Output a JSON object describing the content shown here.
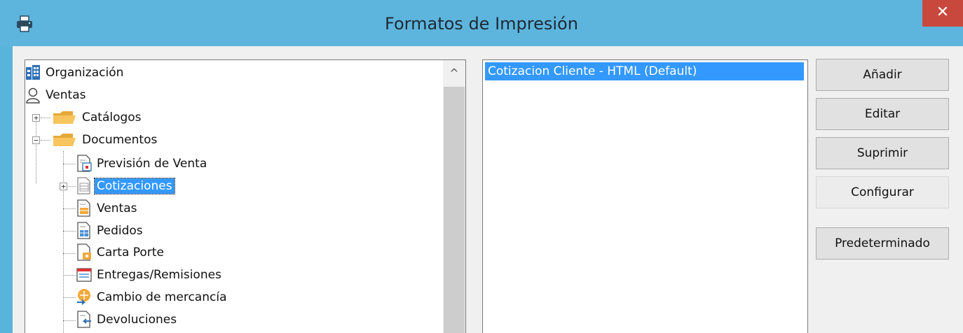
{
  "window": {
    "title": "Formatos de Impresión",
    "close_label": "✕"
  },
  "tree": {
    "items": [
      {
        "label": "Organización",
        "icon": "building-icon"
      },
      {
        "label": "Ventas",
        "icon": "user-icon"
      },
      {
        "label": "Catálogos",
        "icon": "folder-icon",
        "expander": "+"
      },
      {
        "label": "Documentos",
        "icon": "folder-icon",
        "expander": "−"
      },
      {
        "label": "Previsión de Venta",
        "icon": "document-calendar-icon"
      },
      {
        "label": "Cotizaciones",
        "icon": "document-list-icon",
        "expander": "+",
        "selected": true
      },
      {
        "label": "Ventas",
        "icon": "document-orange-icon"
      },
      {
        "label": "Pedidos",
        "icon": "document-blue-icon"
      },
      {
        "label": "Carta Porte",
        "icon": "document-truck-icon"
      },
      {
        "label": "Entregas/Remisiones",
        "icon": "delivery-icon"
      },
      {
        "label": "Cambio de mercancía",
        "icon": "exchange-icon"
      },
      {
        "label": "Devoluciones",
        "icon": "return-icon"
      }
    ],
    "scroll_up_glyph": "^"
  },
  "formats": {
    "items": [
      {
        "label": "Cotizacion Cliente - HTML (Default)",
        "selected": true
      }
    ]
  },
  "buttons": {
    "add": "Añadir",
    "edit": "Editar",
    "delete": "Suprimir",
    "configure": "Configurar",
    "set_default": "Predeterminado"
  },
  "colors": {
    "titlebar": "#5db5de",
    "selection": "#3399ff",
    "close": "#c9483d"
  }
}
